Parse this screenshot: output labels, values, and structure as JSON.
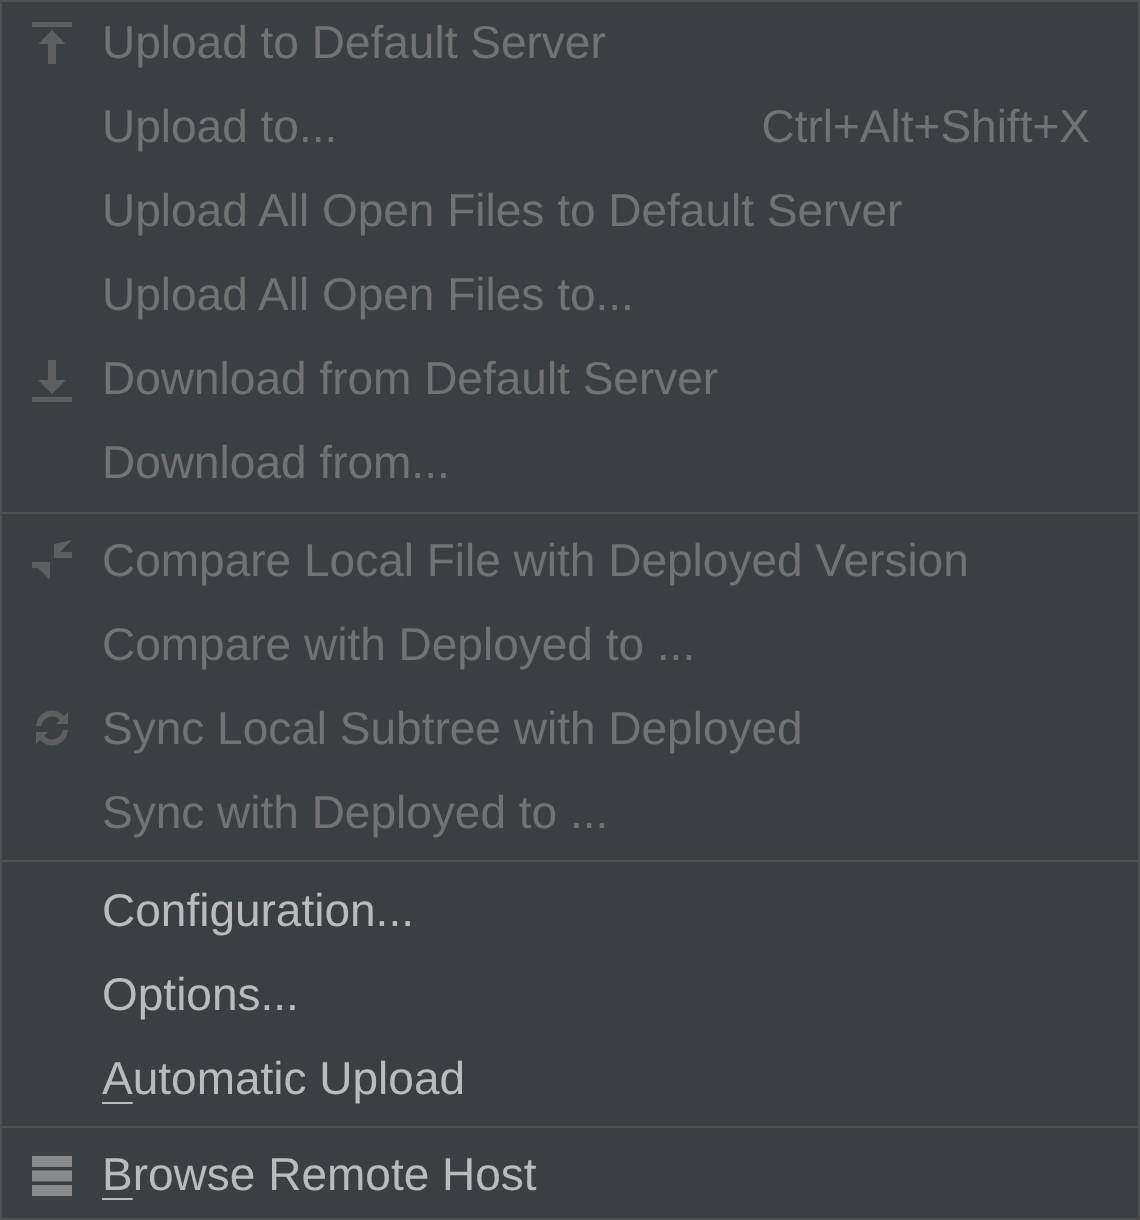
{
  "menu": {
    "groups": [
      {
        "items": [
          {
            "label": "Upload to Default Server",
            "disabled": true,
            "kind": "upload"
          },
          {
            "label": "Upload to...",
            "disabled": true,
            "shortcut": "Ctrl+Alt+Shift+X"
          },
          {
            "label": "Upload All Open Files to Default Server",
            "disabled": true
          },
          {
            "label": "Upload All Open Files to...",
            "disabled": true
          },
          {
            "label": "Download from Default Server",
            "disabled": true,
            "kind": "download"
          },
          {
            "label": "Download from...",
            "disabled": true
          }
        ]
      },
      {
        "items": [
          {
            "label": "Compare Local File with Deployed Version",
            "disabled": true,
            "kind": "compare"
          },
          {
            "label": "Compare with Deployed to ...",
            "disabled": true
          },
          {
            "label": "Sync Local Subtree with Deployed",
            "disabled": true,
            "kind": "sync"
          },
          {
            "label": "Sync with Deployed to ...",
            "disabled": true
          }
        ]
      },
      {
        "items": [
          {
            "label": "Configuration...",
            "disabled": false
          },
          {
            "label": "Options...",
            "disabled": false
          },
          {
            "label": "Automatic Upload",
            "disabled": false,
            "mnemonic_underlined": true
          }
        ]
      },
      {
        "items": [
          {
            "label": "Browse Remote Host",
            "disabled": false,
            "kind": "server",
            "mnemonic_underlined": true
          }
        ]
      }
    ]
  }
}
